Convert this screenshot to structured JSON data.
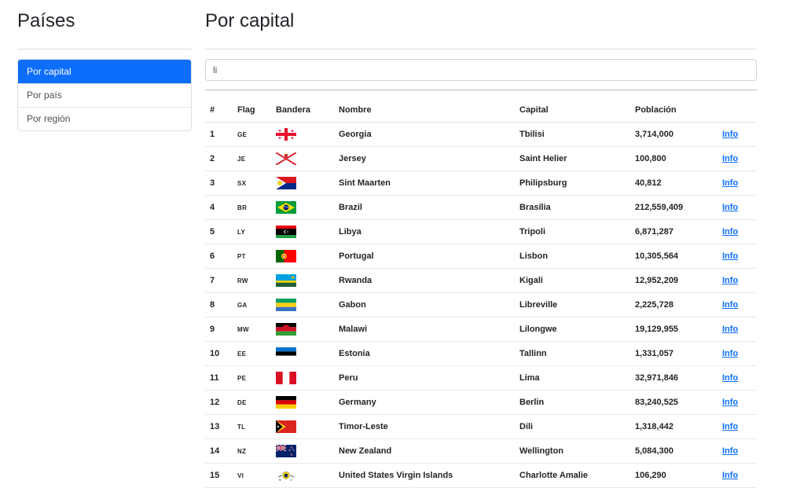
{
  "sidebar": {
    "title": "Países",
    "menu": [
      "Por capital",
      "Por país",
      "Por región"
    ]
  },
  "main": {
    "title": "Por capital",
    "search_value": "li"
  },
  "table": {
    "headers": [
      "#",
      "Flag",
      "Bandera",
      "Nombre",
      "Capital",
      "Población",
      ""
    ],
    "link_label": "Info",
    "rows": [
      {
        "num": "1",
        "code": "GE",
        "name": "Georgia",
        "capital": "Tbilisi",
        "population": "3,714,000",
        "flag": "ge"
      },
      {
        "num": "2",
        "code": "JE",
        "name": "Jersey",
        "capital": "Saint Helier",
        "population": "100,800",
        "flag": "je"
      },
      {
        "num": "3",
        "code": "SX",
        "name": "Sint Maarten",
        "capital": "Philipsburg",
        "population": "40,812",
        "flag": "sx"
      },
      {
        "num": "4",
        "code": "BR",
        "name": "Brazil",
        "capital": "Brasília",
        "population": "212,559,409",
        "flag": "br"
      },
      {
        "num": "5",
        "code": "LY",
        "name": "Libya",
        "capital": "Tripoli",
        "population": "6,871,287",
        "flag": "ly"
      },
      {
        "num": "6",
        "code": "PT",
        "name": "Portugal",
        "capital": "Lisbon",
        "population": "10,305,564",
        "flag": "pt"
      },
      {
        "num": "7",
        "code": "RW",
        "name": "Rwanda",
        "capital": "Kigali",
        "population": "12,952,209",
        "flag": "rw"
      },
      {
        "num": "8",
        "code": "GA",
        "name": "Gabon",
        "capital": "Libreville",
        "population": "2,225,728",
        "flag": "ga"
      },
      {
        "num": "9",
        "code": "MW",
        "name": "Malawi",
        "capital": "Lilongwe",
        "population": "19,129,955",
        "flag": "mw"
      },
      {
        "num": "10",
        "code": "EE",
        "name": "Estonia",
        "capital": "Tallinn",
        "population": "1,331,057",
        "flag": "ee"
      },
      {
        "num": "11",
        "code": "PE",
        "name": "Peru",
        "capital": "Lima",
        "population": "32,971,846",
        "flag": "pe"
      },
      {
        "num": "12",
        "code": "DE",
        "name": "Germany",
        "capital": "Berlin",
        "population": "83,240,525",
        "flag": "de"
      },
      {
        "num": "13",
        "code": "TL",
        "name": "Timor-Leste",
        "capital": "Dili",
        "population": "1,318,442",
        "flag": "tl"
      },
      {
        "num": "14",
        "code": "NZ",
        "name": "New Zealand",
        "capital": "Wellington",
        "population": "5,084,300",
        "flag": "nz"
      },
      {
        "num": "15",
        "code": "VI",
        "name": "United States Virgin Islands",
        "capital": "Charlotte Amalie",
        "population": "106,290",
        "flag": "vi"
      }
    ]
  },
  "colors": {
    "accent": "#0d6efd",
    "link": "#0d6efd"
  }
}
